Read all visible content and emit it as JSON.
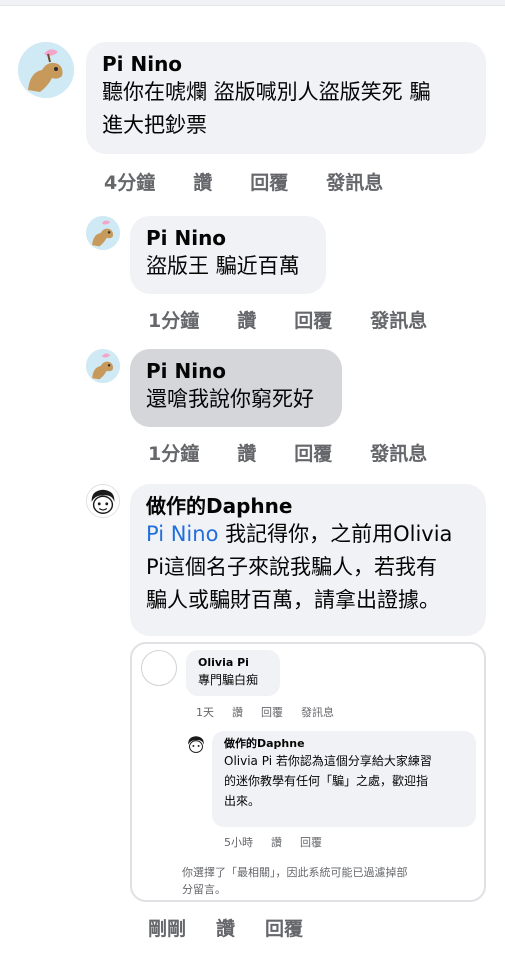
{
  "comments": [
    {
      "author": "Pi Nino",
      "text": "聽你在唬爛 盜版喊別人盜版笑死 騙進大把鈔票",
      "text_line1": "聽你在唬爛 盜版喊別人盜版笑死 騙",
      "text_line2": "進大把鈔票",
      "time": "4分鐘",
      "like": "讚",
      "reply": "回覆",
      "message": "發訊息"
    },
    {
      "author": "Pi Nino",
      "text": "盜版王 騙近百萬",
      "time": "1分鐘",
      "like": "讚",
      "reply": "回覆",
      "message": "發訊息"
    },
    {
      "author": "Pi Nino",
      "text": "還嗆我說你窮死好",
      "time": "1分鐘",
      "like": "讚",
      "reply": "回覆",
      "message": "發訊息"
    },
    {
      "author": "做作的Daphne",
      "mention": "Pi Nino",
      "text_line1": " 我記得你，之前用Olivia",
      "text_line2": "Pi這個名子來說我騙人，若我有",
      "text_line3": "騙人或騙財百萬，請拿出證據。"
    }
  ],
  "screenshot": {
    "comment1": {
      "author": "Olivia Pi",
      "text": "專門騙白痴",
      "time": "1天",
      "like": "讚",
      "reply": "回覆",
      "message": "發訊息"
    },
    "comment2": {
      "author": "做作的Daphne",
      "text_line1": "Olivia Pi 若你認為這個分享給大家練習",
      "text_line2": "的迷你教學有任何「騙」之處，歡迎指",
      "text_line3": "出來。",
      "time": "5小時",
      "like": "讚",
      "reply": "回覆"
    },
    "notice_line1": "你選擇了「最相關」，因此系統可能已過濾掉部",
    "notice_line2": "分留言。"
  },
  "bottom_actions": {
    "time": "剛剛",
    "like": "讚",
    "reply": "回覆"
  },
  "colors": {
    "bubble": "#f0f2f5",
    "bubble_pressed": "#d4d6da",
    "meta_text": "#65676b",
    "mention": "#216fdb"
  },
  "icons": {
    "pi_nino_avatar": "camel-avatar-icon",
    "daphne_avatar": "cartoon-face-avatar-icon"
  }
}
